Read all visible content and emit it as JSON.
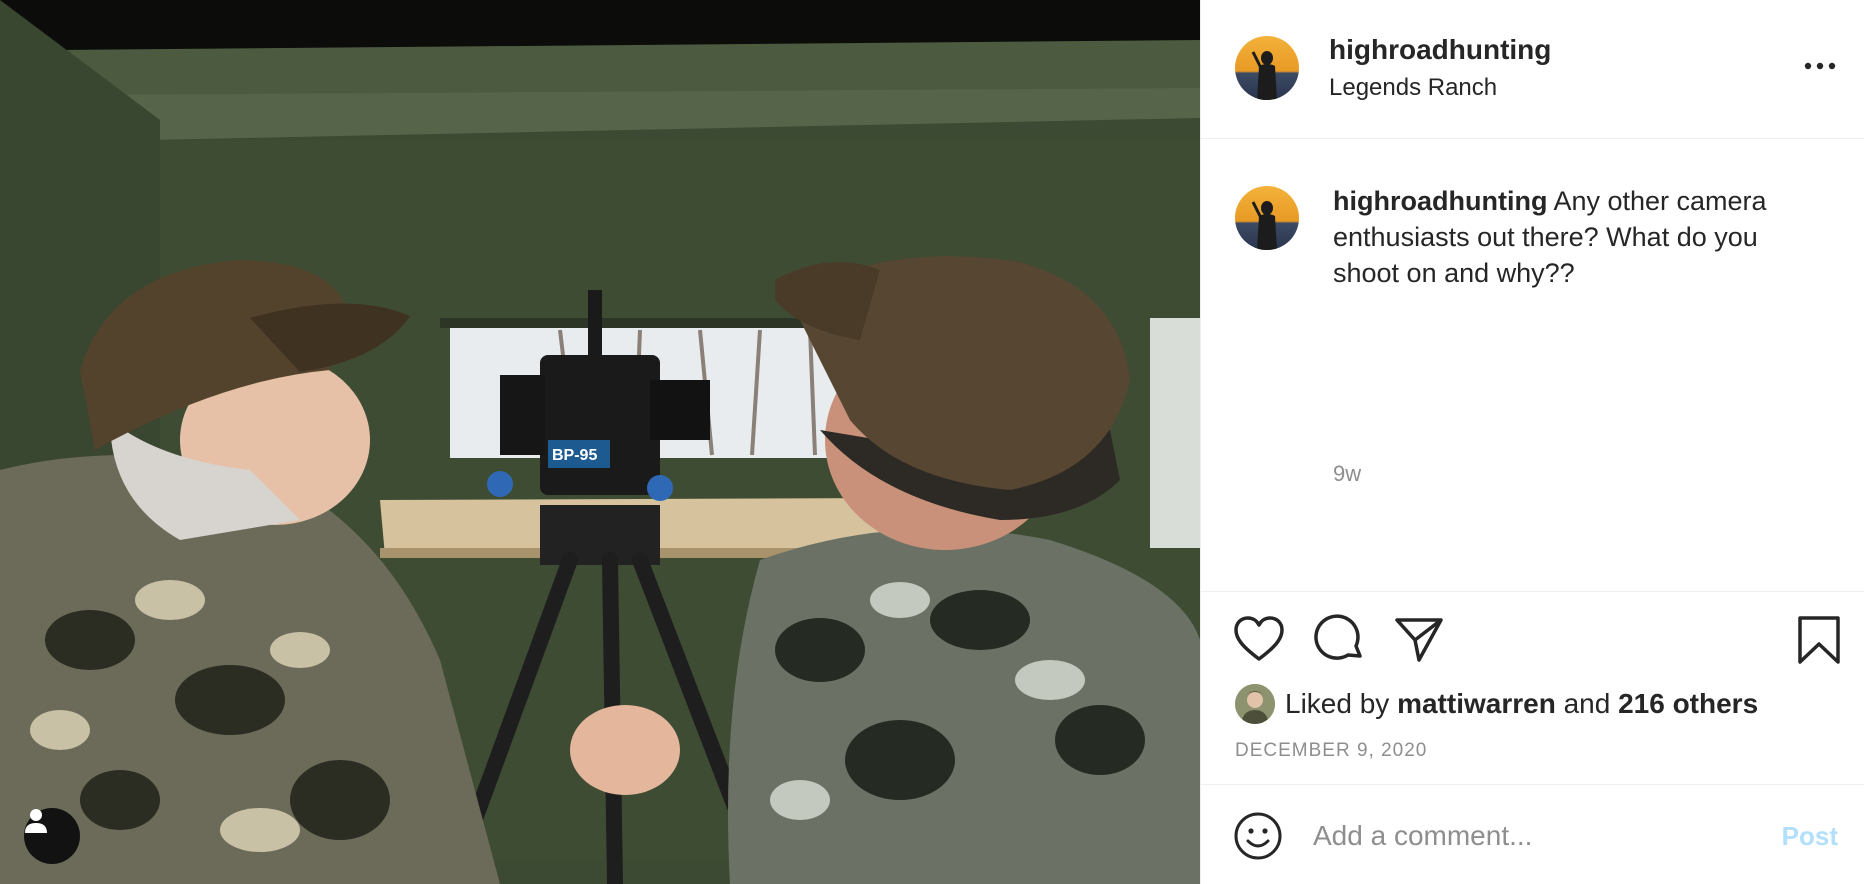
{
  "post": {
    "username": "highroadhunting",
    "location": "Legends Ranch",
    "caption": {
      "username": "highroadhunting",
      "text": "Any other camera enthusiasts out there? What do you shoot on and why??",
      "time_ago": "9w"
    },
    "likes": {
      "prefix": "Liked by",
      "liker": "mattiwarren",
      "joiner": "and",
      "others": "216 others"
    },
    "date": "DECEMBER 9, 2020"
  },
  "photo": {
    "battery_label": "BP-95"
  },
  "comment": {
    "placeholder": "Add a comment...",
    "post_label": "Post"
  },
  "icons": {
    "more": "more-options-icon",
    "like": "heart-icon",
    "comment": "comment-icon",
    "share": "paper-plane-icon",
    "save": "bookmark-icon",
    "emoji": "smiley-icon",
    "user_tag": "person-icon"
  },
  "colors": {
    "post_button_disabled": "#b2dffc",
    "secondary_text": "#8e8e8e",
    "primary_text": "#262626",
    "divider": "#efefef"
  }
}
